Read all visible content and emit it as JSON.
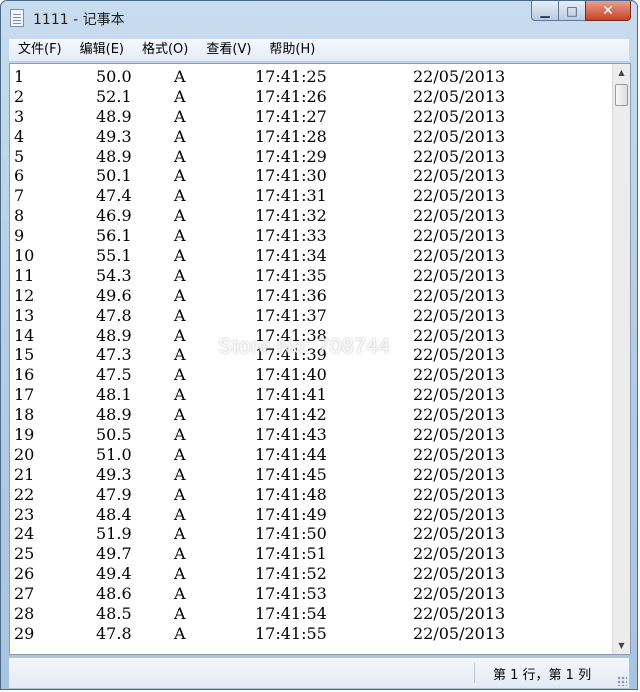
{
  "window": {
    "title": "1111 - 记事本"
  },
  "menu": [
    "文件(F)",
    "编辑(E)",
    "格式(O)",
    "查看(V)",
    "帮助(H)"
  ],
  "rows": [
    [
      "1",
      "50.0",
      "A",
      "17:41:25",
      "22/05/2013"
    ],
    [
      "2",
      "52.1",
      "A",
      "17:41:26",
      "22/05/2013"
    ],
    [
      "3",
      "48.9",
      "A",
      "17:41:27",
      "22/05/2013"
    ],
    [
      "4",
      "49.3",
      "A",
      "17:41:28",
      "22/05/2013"
    ],
    [
      "5",
      "48.9",
      "A",
      "17:41:29",
      "22/05/2013"
    ],
    [
      "6",
      "50.1",
      "A",
      "17:41:30",
      "22/05/2013"
    ],
    [
      "7",
      "47.4",
      "A",
      "17:41:31",
      "22/05/2013"
    ],
    [
      "8",
      "46.9",
      "A",
      "17:41:32",
      "22/05/2013"
    ],
    [
      "9",
      "56.1",
      "A",
      "17:41:33",
      "22/05/2013"
    ],
    [
      "10",
      "55.1",
      "A",
      "17:41:34",
      "22/05/2013"
    ],
    [
      "11",
      "54.3",
      "A",
      "17:41:35",
      "22/05/2013"
    ],
    [
      "12",
      "49.6",
      "A",
      "17:41:36",
      "22/05/2013"
    ],
    [
      "13",
      "47.8",
      "A",
      "17:41:37",
      "22/05/2013"
    ],
    [
      "14",
      "48.9",
      "A",
      "17:41:38",
      "22/05/2013"
    ],
    [
      "15",
      "47.3",
      "A",
      "17:41:39",
      "22/05/2013"
    ],
    [
      "16",
      "47.5",
      "A",
      "17:41:40",
      "22/05/2013"
    ],
    [
      "17",
      "48.1",
      "A",
      "17:41:41",
      "22/05/2013"
    ],
    [
      "18",
      "48.9",
      "A",
      "17:41:42",
      "22/05/2013"
    ],
    [
      "19",
      "50.5",
      "A",
      "17:41:43",
      "22/05/2013"
    ],
    [
      "20",
      "51.0",
      "A",
      "17:41:44",
      "22/05/2013"
    ],
    [
      "21",
      "49.3",
      "A",
      "17:41:45",
      "22/05/2013"
    ],
    [
      "22",
      "47.9",
      "A",
      "17:41:48",
      "22/05/2013"
    ],
    [
      "23",
      "48.4",
      "A",
      "17:41:49",
      "22/05/2013"
    ],
    [
      "24",
      "51.9",
      "A",
      "17:41:50",
      "22/05/2013"
    ],
    [
      "25",
      "49.7",
      "A",
      "17:41:51",
      "22/05/2013"
    ],
    [
      "26",
      "49.4",
      "A",
      "17:41:52",
      "22/05/2013"
    ],
    [
      "27",
      "48.6",
      "A",
      "17:41:53",
      "22/05/2013"
    ],
    [
      "28",
      "48.5",
      "A",
      "17:41:54",
      "22/05/2013"
    ],
    [
      "29",
      "47.8",
      "A",
      "17:41:55",
      "22/05/2013"
    ]
  ],
  "watermark": "Store No: 708744",
  "status": {
    "position": "第 1 行，第 1 列"
  },
  "icons": {
    "app": "notepad-icon",
    "minimize": "minimize-icon",
    "maximize": "maximize-icon",
    "close": "close-icon",
    "scroll_up": "scroll-up-arrow-icon",
    "scroll_down": "scroll-down-arrow-icon",
    "resize": "resize-grip-icon"
  },
  "colors": {
    "titlebar": "#b7cfe7",
    "close_button": "#c7432a",
    "editor_bg": "#ffffff"
  }
}
